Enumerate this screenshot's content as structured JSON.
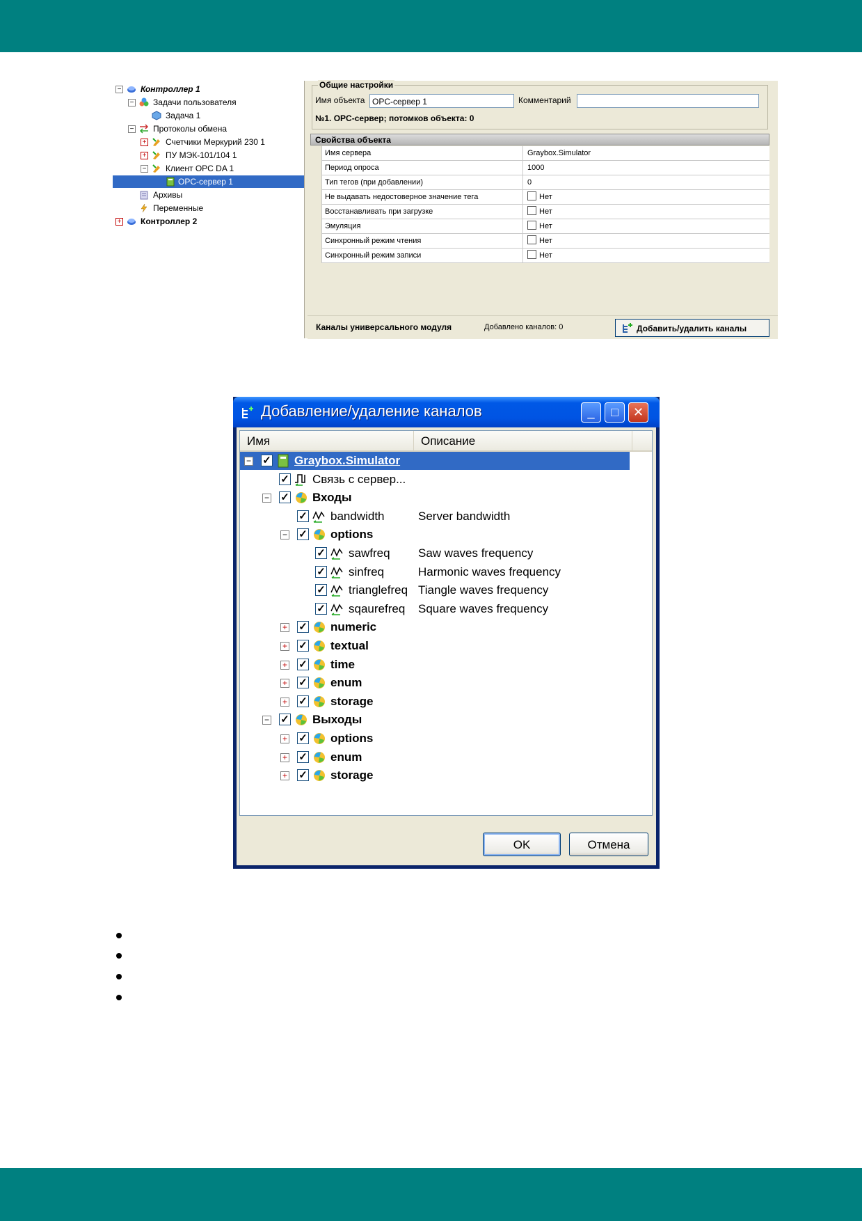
{
  "tree1": {
    "items": [
      {
        "label": "Контроллер 1",
        "expander": "⊟"
      },
      {
        "label": "Задачи пользователя",
        "expander": "⊟"
      },
      {
        "label": "Задача 1"
      },
      {
        "label": "Протоколы обмена",
        "expander": "⊟"
      },
      {
        "label": "Счетчики Меркурий 230 1",
        "expander": "+"
      },
      {
        "label": "ПУ МЭК-101/104 1",
        "expander": "+"
      },
      {
        "label": "Клиент OPC DA 1",
        "expander": "⊟"
      },
      {
        "label": "OPC-сервер 1",
        "selected": true
      },
      {
        "label": "Архивы"
      },
      {
        "label": "Переменные"
      },
      {
        "label": "Контроллер 2",
        "expander": "+"
      }
    ]
  },
  "general": {
    "title": "Общие настройки",
    "name_label": "Имя объекта",
    "name_value": "OPC-сервер 1",
    "comment_label": "Комментарий",
    "comment_value": "",
    "info": "№1. OPC-сервер; потомков объекта: 0"
  },
  "props": {
    "title": "Свойства объекта",
    "rows": [
      {
        "key": "Имя сервера",
        "value": "Graybox.Simulator"
      },
      {
        "key": "Период опроса",
        "value": "1000"
      },
      {
        "key": "Тип тегов (при добавлении)",
        "value": "0"
      },
      {
        "key": "Не выдавать недостоверное значение тега",
        "value": "Нет",
        "checkbox": true
      },
      {
        "key": "Восстанавливать при загрузке",
        "value": "Нет",
        "checkbox": true
      },
      {
        "key": "Эмуляция",
        "value": "Нет",
        "checkbox": true
      },
      {
        "key": "Синхронный режим чтения",
        "value": "Нет",
        "checkbox": true
      },
      {
        "key": "Синхронный режим записи",
        "value": "Нет",
        "checkbox": true
      }
    ]
  },
  "channels": {
    "label": "Каналы универсального модуля",
    "count_text": "Добавлено каналов: 0",
    "button": "Добавить/удалить каналы"
  },
  "dialog": {
    "title": "Добавление/удаление каналов",
    "col_name": "Имя",
    "col_desc": "Описание",
    "ok": "OK",
    "cancel": "Отмена",
    "rows": [
      {
        "name": "Graybox.Simulator",
        "desc": "",
        "expander": "⊟",
        "checked": true,
        "icon": "server-icon"
      },
      {
        "name": "Связь с сервер...",
        "desc": "",
        "checked": true,
        "icon": "pulse-tag-icon"
      },
      {
        "name": "Входы",
        "desc": "",
        "expander": "⊟",
        "checked": true,
        "icon": "folder-ball-icon"
      },
      {
        "name": "bandwidth",
        "desc": "Server bandwidth",
        "checked": true,
        "icon": "wave-tag-icon"
      },
      {
        "name": "options",
        "desc": "",
        "expander": "⊟",
        "checked": true,
        "icon": "folder-ball-icon"
      },
      {
        "name": "sawfreq",
        "desc": "Saw waves frequency",
        "checked": true,
        "icon": "wave-tag-icon"
      },
      {
        "name": "sinfreq",
        "desc": "Harmonic waves frequency",
        "checked": true,
        "icon": "wave-tag-icon"
      },
      {
        "name": "trianglefreq",
        "desc": "Tiangle waves frequency",
        "checked": true,
        "icon": "wave-tag-icon"
      },
      {
        "name": "sqaurefreq",
        "desc": "Square waves frequency",
        "checked": true,
        "icon": "wave-tag-icon"
      },
      {
        "name": "numeric",
        "desc": "",
        "expander": "+",
        "checked": true,
        "icon": "folder-ball-icon"
      },
      {
        "name": "textual",
        "desc": "",
        "expander": "+",
        "checked": true,
        "icon": "folder-ball-icon"
      },
      {
        "name": "time",
        "desc": "",
        "expander": "+",
        "checked": true,
        "icon": "folder-ball-icon"
      },
      {
        "name": "enum",
        "desc": "",
        "expander": "+",
        "checked": true,
        "icon": "folder-ball-icon"
      },
      {
        "name": "storage",
        "desc": "",
        "expander": "+",
        "checked": true,
        "icon": "folder-ball-icon"
      },
      {
        "name": "Выходы",
        "desc": "",
        "expander": "⊟",
        "checked": true,
        "icon": "folder-ball-icon"
      },
      {
        "name": "options",
        "desc": "",
        "expander": "+",
        "checked": true,
        "icon": "folder-ball-icon"
      },
      {
        "name": "enum",
        "desc": "",
        "expander": "+",
        "checked": true,
        "icon": "folder-ball-icon"
      },
      {
        "name": "storage",
        "desc": "",
        "expander": "+",
        "checked": true,
        "icon": "folder-ball-icon"
      }
    ]
  },
  "colors": {
    "band": "#008080",
    "selection": "#316ac5",
    "xp_title": "#0054e3"
  }
}
